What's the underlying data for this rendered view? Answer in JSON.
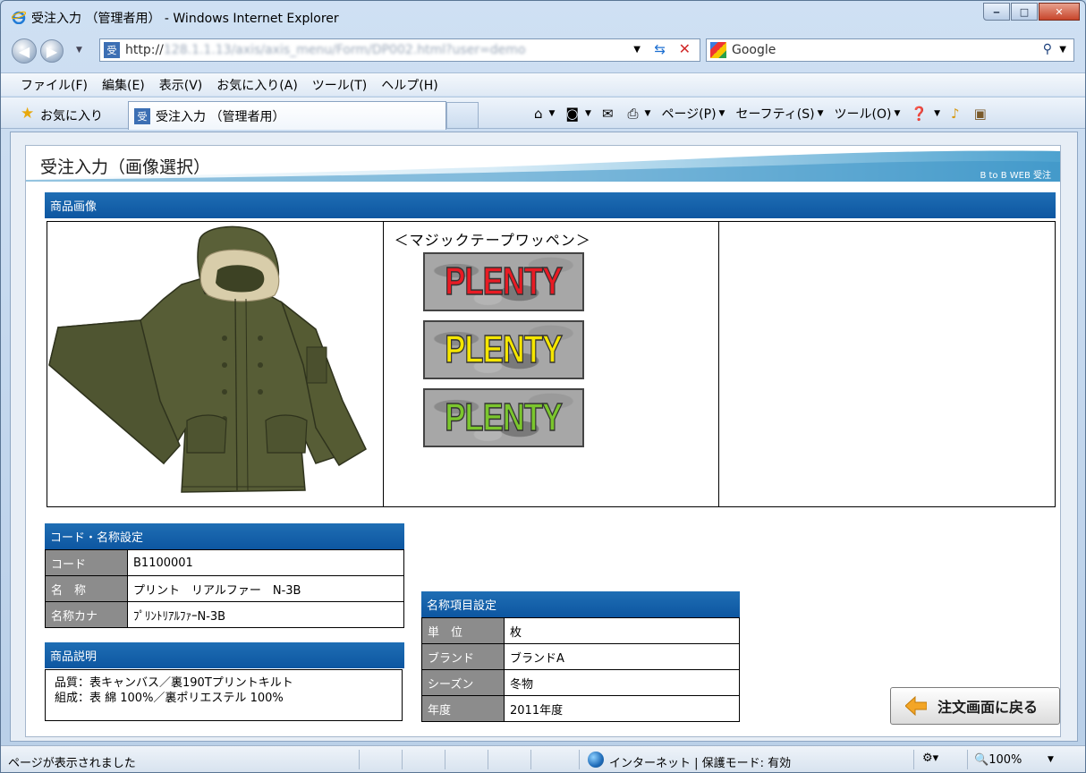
{
  "window": {
    "title": "受注入力 （管理者用） - Windows Internet Explorer",
    "min": "‒",
    "max": "□",
    "close": "✕"
  },
  "address": {
    "scheme": "http://",
    "rest": "128.1.1.13/axis/axis_menu/Form/DP002.html?user=demo",
    "favicon": "受"
  },
  "search": {
    "placeholder": "Google"
  },
  "menu": [
    "ファイル(F)",
    "編集(E)",
    "表示(V)",
    "お気に入り(A)",
    "ツール(T)",
    "ヘルプ(H)"
  ],
  "favorites": {
    "label": "お気に入り",
    "tab_title": "受注入力 （管理者用）",
    "tab_favicon": "受"
  },
  "commandbar": {
    "page": "ページ(P)",
    "safety": "セーフティ(S)",
    "tools": "ツール(O)"
  },
  "page": {
    "title": "受注入力（画像選択）",
    "subtitle": "B to B WEB 受注",
    "image_section": "商品画像",
    "patch_title": "＜マジックテープワッペン＞",
    "patches": [
      {
        "text": "PLENTY",
        "color": "#e81b24"
      },
      {
        "text": "PLENTY",
        "color": "#f5e600"
      },
      {
        "text": "PLENTY",
        "color": "#7bc62d"
      }
    ]
  },
  "code_section": {
    "title": "コード・名称設定",
    "rows": [
      {
        "label": "コード",
        "value": "B1100001"
      },
      {
        "label": "名　称",
        "value": "プリント　リアルファー　N-3B"
      },
      {
        "label": "名称カナ",
        "value": "ﾌﾟﾘﾝﾄﾘｱﾙﾌｧｰN-3B"
      }
    ]
  },
  "desc_section": {
    "title": "商品説明",
    "line1": "品質：表キャンバス／裏190Tプリントキルト",
    "line2": "組成：表 綿 100%／裏ポリエステル 100%"
  },
  "name_section": {
    "title": "名称項目設定",
    "rows": [
      {
        "label": "単　位",
        "value": "枚"
      },
      {
        "label": "ブランド",
        "value": "ブランドA"
      },
      {
        "label": "シーズン",
        "value": "冬物"
      },
      {
        "label": "年度",
        "value": "2011年度"
      }
    ]
  },
  "back_button": "注文画面に戻る",
  "status": {
    "text": "ページが表示されました",
    "zone": "インターネット | 保護モード: 有効",
    "zoom": "100%"
  },
  "colors": {
    "section_header": "#0d56a1",
    "label_cell": "#8c8c8c"
  }
}
